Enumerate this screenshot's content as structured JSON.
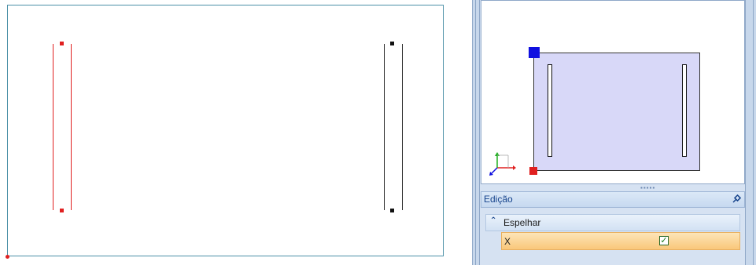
{
  "panel": {
    "title": "Edição",
    "pin_icon": "pin-icon"
  },
  "group": {
    "label": "Espelhar",
    "expanded": true
  },
  "property": {
    "label": "X",
    "checked": true
  },
  "colors": {
    "accent_red": "#e02020",
    "handle_blue": "#1010e0",
    "preview_fill": "#d8d8f8",
    "selection_row": "#f9c77a"
  }
}
